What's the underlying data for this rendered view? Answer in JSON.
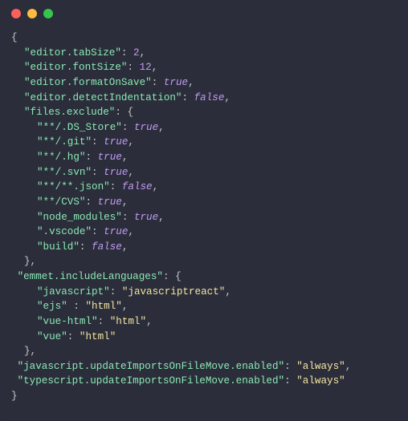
{
  "traffic_lights": {
    "close": "#fc605c",
    "min": "#fdbc40",
    "max": "#34c749"
  },
  "code": {
    "open": "{",
    "close": "}",
    "settings": [
      {
        "key": "\"editor.tabSize\"",
        "sep": ": ",
        "val": "2",
        "vclass": "n",
        "comma": ","
      },
      {
        "key": "\"editor.fontSize\"",
        "sep": ": ",
        "val": "12",
        "vclass": "n",
        "comma": ","
      },
      {
        "key": "\"editor.formatOnSave\"",
        "sep": ": ",
        "val": "true",
        "vclass": "b",
        "comma": ","
      },
      {
        "key": "\"editor.detectIndentation\"",
        "sep": ": ",
        "val": "false",
        "vclass": "b",
        "comma": ","
      }
    ],
    "filesExclude": {
      "key": "\"files.exclude\"",
      "sep": ": {",
      "close": "},",
      "items": [
        {
          "key": "\"**/.DS_Store\"",
          "sep": ": ",
          "val": "true",
          "vclass": "b",
          "comma": ","
        },
        {
          "key": "\"**/.git\"",
          "sep": ": ",
          "val": "true",
          "vclass": "b",
          "comma": ","
        },
        {
          "key": "\"**/.hg\"",
          "sep": ": ",
          "val": "true",
          "vclass": "b",
          "comma": ","
        },
        {
          "key": "\"**/.svn\"",
          "sep": ": ",
          "val": "true",
          "vclass": "b",
          "comma": ","
        },
        {
          "key": "\"**/**.json\"",
          "sep": ": ",
          "val": "false",
          "vclass": "b",
          "comma": ","
        },
        {
          "key": "\"**/CVS\"",
          "sep": ": ",
          "val": "true",
          "vclass": "b",
          "comma": ","
        },
        {
          "key": "\"node_modules\"",
          "sep": ": ",
          "val": "true",
          "vclass": "b",
          "comma": ","
        },
        {
          "key": "\".vscode\"",
          "sep": ": ",
          "val": "true",
          "vclass": "b",
          "comma": ","
        },
        {
          "key": "\"build\"",
          "sep": ": ",
          "val": "false",
          "vclass": "b",
          "comma": ","
        }
      ]
    },
    "emmet": {
      "key": "\"emmet.includeLanguages\"",
      "sep": ": {",
      "close": "},",
      "items": [
        {
          "key": "\"javascript\"",
          "sep": ": ",
          "val": "\"javascriptreact\"",
          "vclass": "s",
          "comma": ","
        },
        {
          "key": "\"ejs\" ",
          "sep": ": ",
          "val": "\"html\"",
          "vclass": "s",
          "comma": ","
        },
        {
          "key": "\"vue-html\"",
          "sep": ": ",
          "val": "\"html\"",
          "vclass": "s",
          "comma": ","
        },
        {
          "key": "\"vue\"",
          "sep": ": ",
          "val": "\"html\"",
          "vclass": "s",
          "comma": ""
        }
      ]
    },
    "tail": [
      {
        "key": "\"javascript.updateImportsOnFileMove.enabled\"",
        "sep": ": ",
        "val": "\"always\"",
        "vclass": "s",
        "comma": ","
      },
      {
        "key": "\"typescript.updateImportsOnFileMove.enabled\"",
        "sep": ": ",
        "val": "\"always\"",
        "vclass": "s",
        "comma": ""
      }
    ]
  }
}
